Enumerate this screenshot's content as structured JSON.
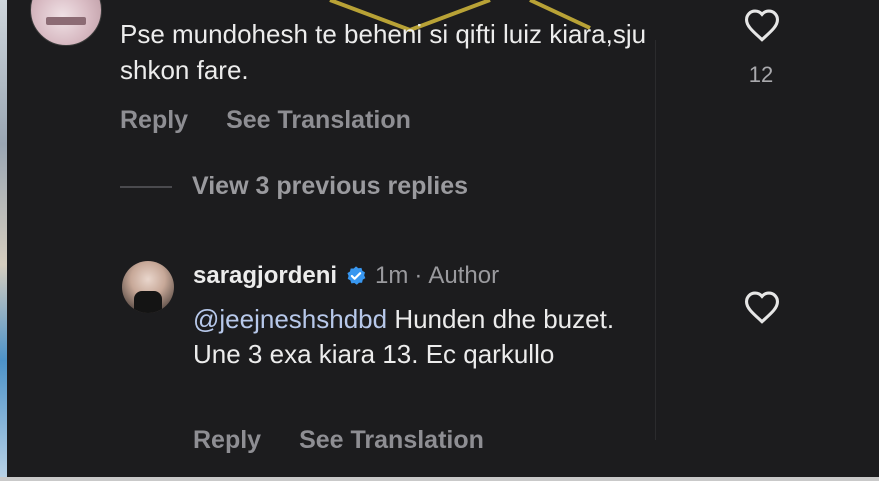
{
  "comment": {
    "text": "Pse mundohesh te beheni si qifti luiz kiara,sju shkon fare.",
    "reply_label": "Reply",
    "translation_label": "See Translation",
    "like_count": "12"
  },
  "view_replies": {
    "label": "View 3 previous replies"
  },
  "reply": {
    "username": "saragjordeni",
    "time": "1m",
    "separator": "·",
    "author_label": "Author",
    "mention": "@jeejneshshdbd",
    "text": " Hunden dhe buzet. Une 3 exa kiara 13. Ec qarkullo",
    "reply_label": "Reply",
    "translation_label": "See Translation"
  },
  "colors": {
    "background": "#1c1c1e",
    "verified": "#3897f0",
    "secondary_text": "#8e8e93"
  },
  "icons": [
    "heart-icon",
    "verified-badge-icon"
  ]
}
